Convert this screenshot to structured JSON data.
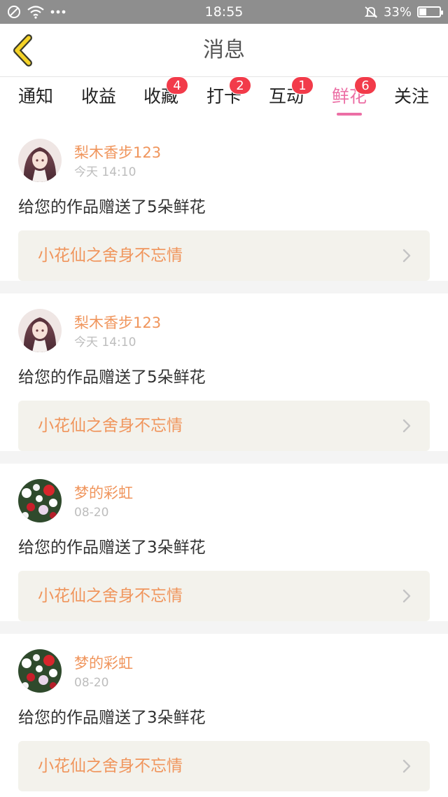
{
  "status_bar": {
    "time": "18:55",
    "battery_percent": "33%",
    "battery_level": 0.33
  },
  "header": {
    "title": "消息",
    "back_icon": "chevron-left-icon"
  },
  "tabs": [
    {
      "label": "通知",
      "badge": ""
    },
    {
      "label": "收益",
      "badge": ""
    },
    {
      "label": "收藏",
      "badge": "4"
    },
    {
      "label": "打卡",
      "badge": "2"
    },
    {
      "label": "互动",
      "badge": "1"
    },
    {
      "label": "鲜花",
      "badge": "6",
      "active": true
    },
    {
      "label": "关注",
      "badge": ""
    }
  ],
  "messages": [
    {
      "user": "梨木香步123",
      "time": "今天 14:10",
      "text": "给您的作品赠送了5朵鲜花",
      "work": "小花仙之舍身不忘情",
      "avatar": "anime-girl"
    },
    {
      "user": "梨木香步123",
      "time": "今天 14:10",
      "text": "给您的作品赠送了5朵鲜花",
      "work": "小花仙之舍身不忘情",
      "avatar": "anime-girl"
    },
    {
      "user": "梦的彩虹",
      "time": "08-20",
      "text": "给您的作品赠送了3朵鲜花",
      "work": "小花仙之舍身不忘情",
      "avatar": "flowers"
    },
    {
      "user": "梦的彩虹",
      "time": "08-20",
      "text": "给您的作品赠送了3朵鲜花",
      "work": "小花仙之舍身不忘情",
      "avatar": "flowers"
    }
  ],
  "colors": {
    "accent": "#ec6fa5",
    "name_orange": "#f0955c",
    "badge_red": "#f23b4a",
    "back_yellow": "#f5d327"
  }
}
